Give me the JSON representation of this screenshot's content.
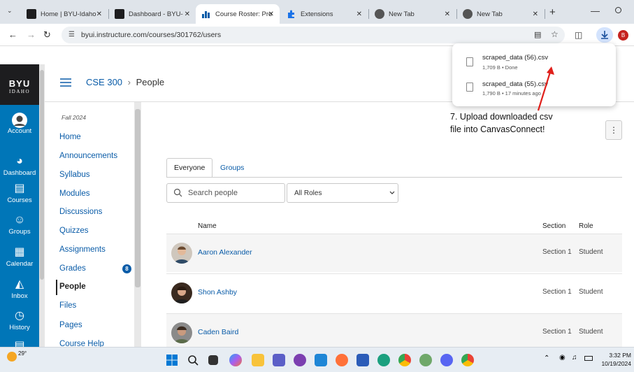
{
  "browser": {
    "tabs": [
      {
        "title": "Home | BYU-Idaho",
        "icon": "byui-favicon",
        "active": false
      },
      {
        "title": "Dashboard - BYU-",
        "icon": "byui-favicon",
        "active": false
      },
      {
        "title": "Course Roster: Pro",
        "icon": "chart-favicon",
        "active": true
      },
      {
        "title": "Extensions",
        "icon": "puzzle-favicon",
        "active": false
      },
      {
        "title": "New Tab",
        "icon": "chrome-favicon",
        "active": false
      },
      {
        "title": "New Tab",
        "icon": "chrome-favicon",
        "active": false
      }
    ],
    "close_glyph": "✕",
    "new_tab_glyph": "+",
    "url": "byui.instructure.com/courses/301762/users",
    "profile_initial": "B"
  },
  "downloads": {
    "items": [
      {
        "name": "scraped_data (56).csv",
        "meta": "1,709 B • Done"
      },
      {
        "name": "scraped_data (55).csv",
        "meta": "1,790 B • 17 minutes ago"
      }
    ]
  },
  "annotation": {
    "line1": "7. Upload downloaded csv",
    "line2": "file into CanvasConnect!",
    "color": "#e0201b"
  },
  "global_nav": {
    "logo_top": "BYU",
    "logo_bottom": "IDAHO",
    "items": [
      {
        "label": "Account",
        "icon": "account-icon"
      },
      {
        "label": "Dashboard",
        "icon": "dashboard-icon"
      },
      {
        "label": "Courses",
        "icon": "courses-icon"
      },
      {
        "label": "Groups",
        "icon": "groups-icon"
      },
      {
        "label": "Calendar",
        "icon": "calendar-icon"
      },
      {
        "label": "Inbox",
        "icon": "inbox-icon"
      },
      {
        "label": "History",
        "icon": "history-icon"
      }
    ],
    "color": "#0076b8"
  },
  "header": {
    "course": "CSE 300",
    "separator": "›",
    "page": "People"
  },
  "course_nav": {
    "term": "Fall 2024",
    "items": [
      {
        "label": "Home"
      },
      {
        "label": "Announcements"
      },
      {
        "label": "Syllabus"
      },
      {
        "label": "Modules"
      },
      {
        "label": "Discussions"
      },
      {
        "label": "Quizzes"
      },
      {
        "label": "Assignments"
      },
      {
        "label": "Grades",
        "badge": "8"
      },
      {
        "label": "People",
        "active": true
      },
      {
        "label": "Files"
      },
      {
        "label": "Pages"
      },
      {
        "label": "Course Help"
      }
    ]
  },
  "people": {
    "tabs": [
      "Everyone",
      "Groups"
    ],
    "search_placeholder": "Search people",
    "roles_selected": "All Roles",
    "columns": {
      "name": "Name",
      "section": "Section",
      "role": "Role"
    },
    "rows": [
      {
        "name": "Aaron Alexander",
        "section": "Section 1",
        "role": "Student"
      },
      {
        "name": "Shon Ashby",
        "section": "Section 1",
        "role": "Student"
      },
      {
        "name": "Caden Baird",
        "section": "Section 1",
        "role": "Student"
      }
    ],
    "kebab": "⋮"
  },
  "taskbar": {
    "weather": "29°",
    "time": "3:32 PM",
    "date": "10/19/2024"
  }
}
